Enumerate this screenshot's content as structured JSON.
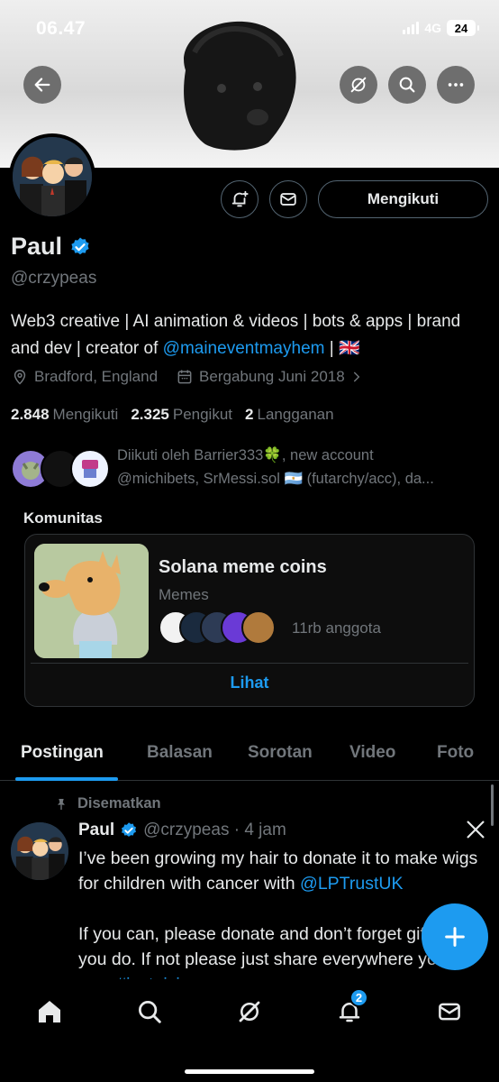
{
  "status_bar": {
    "time": "06.47",
    "network": "4G",
    "battery": "24"
  },
  "header": {
    "back_icon": "arrow-left-icon",
    "grok_icon": "grok-icon",
    "search_icon": "search-icon",
    "more_icon": "more-icon"
  },
  "profile": {
    "name": "Paul",
    "handle": "@crzypeas",
    "verified": true,
    "follow_label": "Mengikuti",
    "bio_part1": "Web3 creative | AI animation & videos | bots & apps | brand and dev | creator of ",
    "bio_link": "@maineventmayhem",
    "bio_part2": " | 🇬🇧",
    "location": "Bradford, England",
    "joined": "Bergabung Juni 2018",
    "following_count": "2.848",
    "following_label": "Mengikuti",
    "followers_count": "2.325",
    "followers_label": "Pengikut",
    "subscriptions_count": "2",
    "subscriptions_label": "Langganan",
    "followed_by_line1": "Diikuti oleh Barrier333🍀, new account",
    "followed_by_line2": "@michibets, SrMessi.sol 🇦🇷 (futarchy/acc), da..."
  },
  "community": {
    "section_label": "Komunitas",
    "title": "Solana meme coins",
    "category": "Memes",
    "members": "11rb anggota",
    "view_label": "Lihat"
  },
  "tabs": [
    {
      "label": "Postingan",
      "active": true
    },
    {
      "label": "Balasan"
    },
    {
      "label": "Sorotan"
    },
    {
      "label": "Video"
    },
    {
      "label": "Foto"
    }
  ],
  "post": {
    "pinned_label": "Disematkan",
    "author": "Paul",
    "meta": "@crzypeas · 4 jam",
    "text_1": "I’ve been growing my hair to donate it to make wigs for children with cancer with ",
    "mention": "@LPTrustUK",
    "text_2": "If you can, please donate and don’t forget gift aid if you do. If not please just share everywhere you can. ",
    "hashtag": "#justgiving"
  },
  "bottom_nav": {
    "notifications_badge": "2"
  },
  "colors": {
    "accent": "#1d9bf0",
    "background": "#000000",
    "muted": "#71767b",
    "border": "#2f3336"
  }
}
